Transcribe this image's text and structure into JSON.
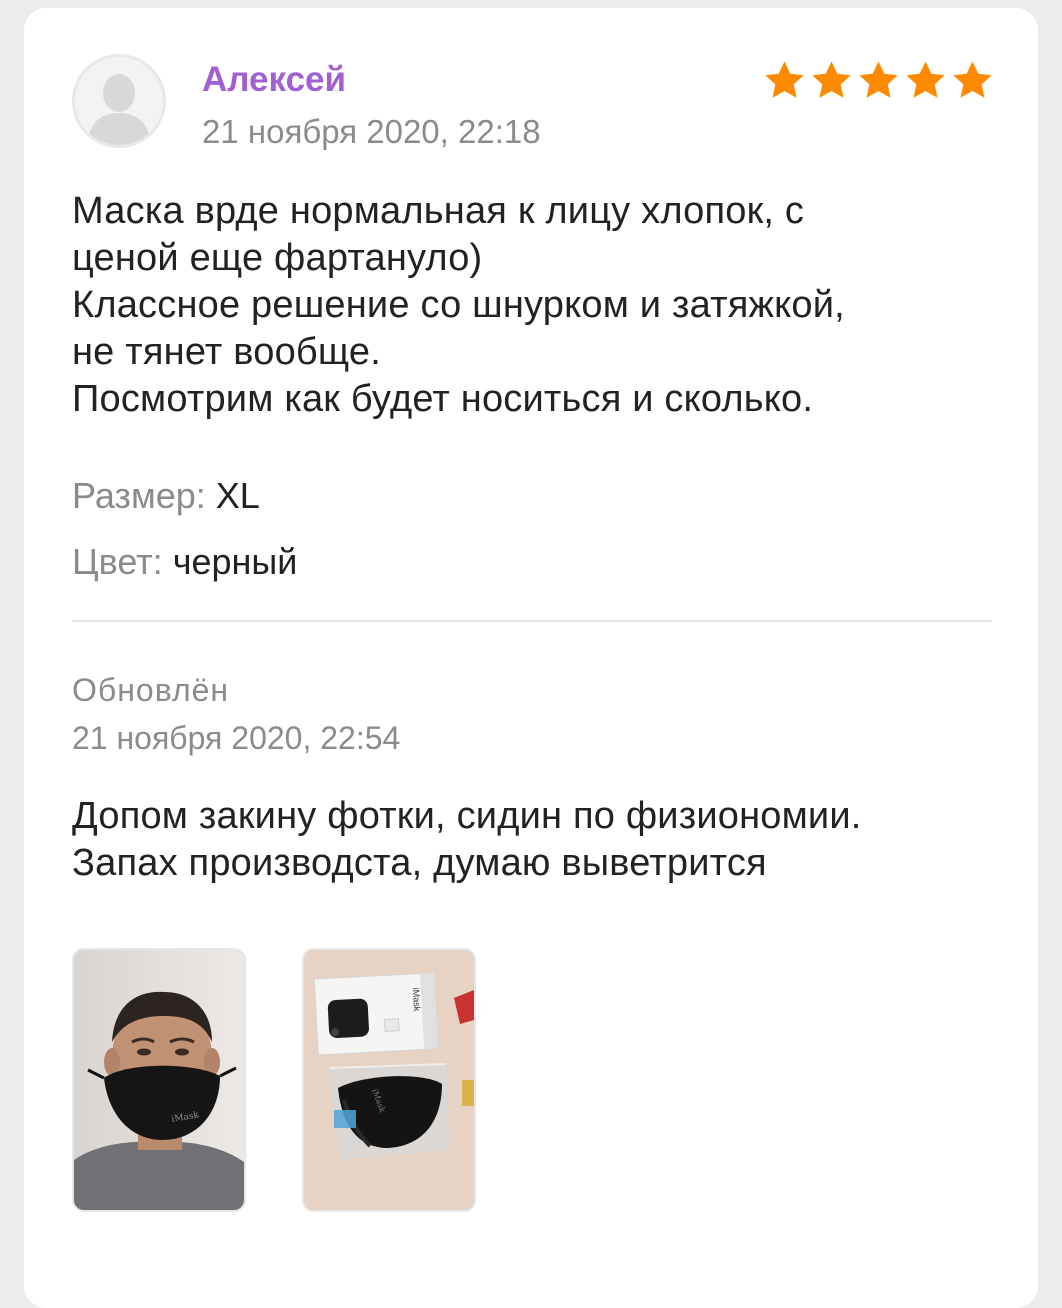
{
  "review": {
    "author": "Алексей",
    "date": "21 ноября 2020, 22:18",
    "rating": 5,
    "rating_max": 5,
    "star_color": "#ff8a00",
    "author_color": "#a05fd3",
    "text_lines": [
      "Маска врде нормальная к лицу хлопок, с",
      "ценой еще фартануло)",
      "Классное решение со шнурком и затяжкой,",
      "не тянет вообще.",
      "Посмотрим как будет носиться и сколько."
    ],
    "size_label": "Размер:",
    "size_value": "XL",
    "color_label": "Цвет:",
    "color_value": "черный"
  },
  "update": {
    "label": "Обновлён",
    "date": "21 ноября 2020, 22:54",
    "text_lines": [
      "Допом закину фотки, сидин по физиономии.",
      "Запах производста, думаю выветрится"
    ]
  },
  "photos": [
    {
      "icon": "photo-man-wearing-mask",
      "mask_brand": "iMask"
    },
    {
      "icon": "photo-mask-package",
      "box_brand": "iMask",
      "mask_brand": "iMask"
    }
  ]
}
